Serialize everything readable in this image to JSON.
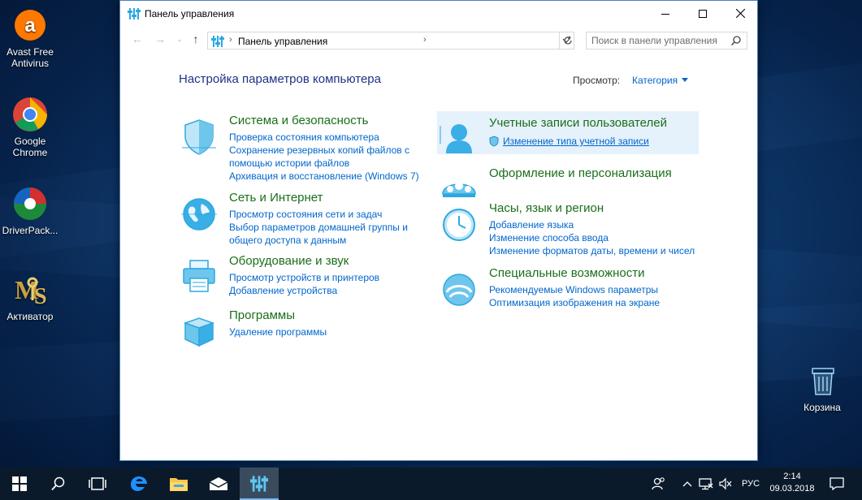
{
  "desktop": {
    "icons": [
      {
        "label": "Avast Free Antivirus"
      },
      {
        "label": "Google Chrome"
      },
      {
        "label": "DriverPack..."
      },
      {
        "label": "Активатор"
      },
      {
        "label": "Корзина"
      }
    ]
  },
  "window": {
    "title": "Панель управления",
    "address": {
      "crumb": "Панель управления"
    },
    "search_placeholder": "Поиск в панели управления",
    "heading": "Настройка параметров компьютера",
    "view_by_label": "Просмотр:",
    "view_by_value": "Категория",
    "categories": [
      {
        "title": "Система и безопасность",
        "icon": "shield-icon",
        "links": [
          "Проверка состояния компьютера",
          "Сохранение резервных копий файлов с",
          "помощью истории файлов",
          "Архивация и восстановление (Windows 7)"
        ]
      },
      {
        "title": "Сеть и Интернет",
        "icon": "globe-icon",
        "links": [
          "Просмотр состояния сети и задач",
          "Выбор параметров домашней группы и",
          "общего доступа к данным"
        ]
      },
      {
        "title": "Оборудование и звук",
        "icon": "printer-icon",
        "links": [
          "Просмотр устройств и принтеров",
          "Добавление устройства"
        ]
      },
      {
        "title": "Программы",
        "icon": "programs-icon",
        "links": [
          "Удаление программы"
        ]
      },
      {
        "title": "Учетные записи пользователей",
        "icon": "user-accounts-icon",
        "links": [
          "Изменение типа учетной записи"
        ]
      },
      {
        "title": "Оформление и персонализация",
        "icon": "personalization-icon",
        "links": []
      },
      {
        "title": "Часы, язык и регион",
        "icon": "clock-icon",
        "links": [
          "Добавление языка",
          "Изменение способа ввода",
          "Изменение форматов даты, времени и чисел"
        ]
      },
      {
        "title": "Специальные возможности",
        "icon": "accessibility-icon",
        "links": [
          "Рекомендуемые Windows параметры",
          "Оптимизация изображения на экране"
        ]
      }
    ]
  },
  "taskbar": {
    "language": "РУС",
    "time": "2:14",
    "date": "09.03.2018"
  },
  "colors": {
    "link": "#0066cc",
    "category_title": "#1a6e1a",
    "heading": "#1e3287",
    "icon_blue": "#2da8e0",
    "highlight": "#e5f1fb"
  }
}
